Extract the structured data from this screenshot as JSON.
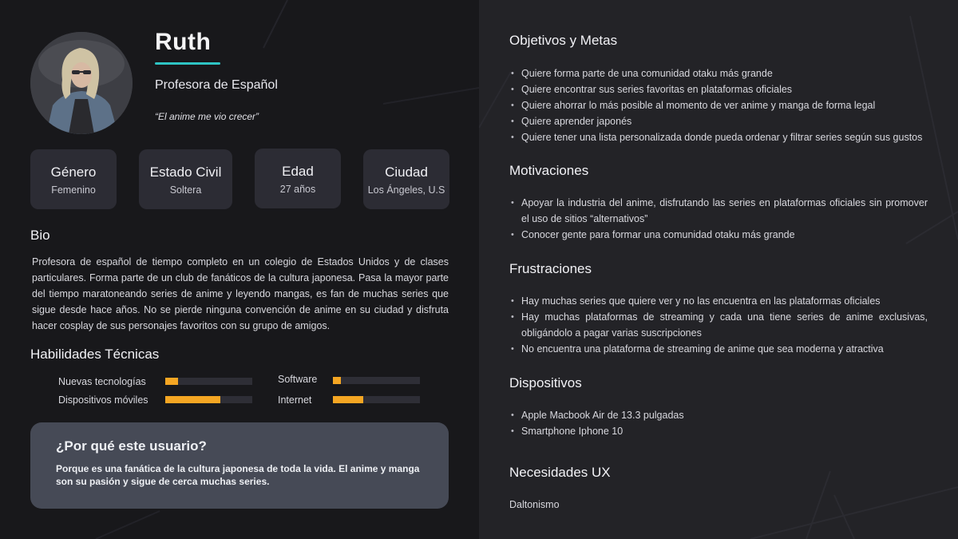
{
  "profile": {
    "name": "Ruth",
    "role": "Profesora de Español",
    "quote": "“El anime me vio crecer”"
  },
  "stats": [
    {
      "label": "Género",
      "value": "Femenino"
    },
    {
      "label": "Estado Civil",
      "value": "Soltera"
    },
    {
      "label": "Edad",
      "value": "27 años"
    },
    {
      "label": "Ciudad",
      "value": "Los Ángeles, U.S"
    }
  ],
  "bio": {
    "title": "Bio",
    "text": "Profesora de español de tiempo completo en un colegio de Estados Unidos y de clases particulares. Forma parte de un club de fanáticos de la cultura japonesa. Pasa la mayor parte del tiempo maratoneando series de anime y leyendo mangas, es fan de muchas series que sigue desde hace años. No se pierde ninguna convención de anime en su ciudad y disfruta hacer cosplay de sus personajes favoritos con su grupo de amigos."
  },
  "skills": {
    "title": "Habilidades Técnicas",
    "items": [
      {
        "label": "Nuevas tecnologías",
        "level": 0.15
      },
      {
        "label": "Dispositivos móviles",
        "level": 0.63
      },
      {
        "label": "Software",
        "level": 0.09
      },
      {
        "label": "Internet",
        "level": 0.35
      }
    ],
    "bar_color": "#f5a623"
  },
  "why": {
    "title": "¿Por qué este usuario?",
    "text": "Porque es una fanática de la cultura japonesa de toda la vida. El anime y manga son su pasión y sigue de cerca muchas series."
  },
  "goals": {
    "title": "Objetivos y Metas",
    "items": [
      "Quiere forma parte de una comunidad otaku más grande",
      "Quiere encontrar sus series favoritas en plataformas oficiales",
      "Quiere ahorrar lo más posible al momento de ver anime y manga de forma legal",
      "Quiere aprender japonés",
      "Quiere tener una lista personalizada donde pueda ordenar y filtrar series según sus gustos"
    ]
  },
  "motivations": {
    "title": "Motivaciones",
    "items": [
      "Apoyar la industria del anime, disfrutando las series en plataformas oficiales sin promover el uso de sitios “alternativos”",
      "Conocer gente para formar una comunidad otaku más grande"
    ]
  },
  "frustrations": {
    "title": "Frustraciones",
    "items": [
      "Hay muchas series que quiere ver y no las encuentra en las plataformas oficiales",
      "Hay muchas plataformas de streaming y cada una tiene series de anime exclusivas, obligándolo a pagar varias suscripciones",
      "No encuentra una plataforma de streaming de anime que sea moderna y atractiva"
    ]
  },
  "devices": {
    "title": "Dispositivos",
    "items": [
      "Apple Macbook Air de 13.3 pulgadas",
      "Smartphone Iphone 10"
    ]
  },
  "ux_needs": {
    "title": "Necesidades UX",
    "text": "Daltonismo"
  },
  "colors": {
    "accent": "#2ec4c4",
    "left_bg": "#18181b",
    "right_bg": "#232327",
    "card_bg": "#2c2c34",
    "why_bg": "#464a56"
  }
}
